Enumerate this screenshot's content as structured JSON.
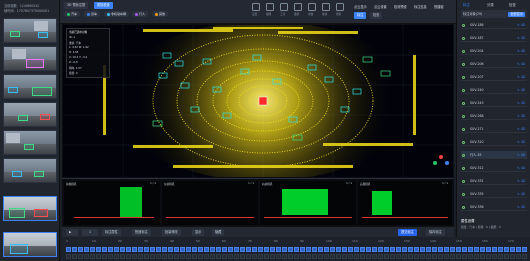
{
  "left": {
    "info_line1": "当前帧数：1/10690542",
    "info_line2": "帧时间：1707807375000001",
    "thumbnails": [
      "cam-1",
      "cam-2",
      "cam-3",
      "cam-4",
      "cam-5",
      "cam-6",
      "cam-7",
      "cam-8"
    ]
  },
  "toolbar": {
    "mode_btn": "3D 预标注框",
    "check_btn": "质检检查",
    "chips": [
      {
        "label": "汽车",
        "color": "#22c55e"
      },
      {
        "label": "货车",
        "color": "#3b82f6"
      },
      {
        "label": "非机动车辆",
        "color": "#38bdf8"
      },
      {
        "label": "行人",
        "color": "#a855f7"
      },
      {
        "label": "其他",
        "color": "#f59e0b"
      }
    ],
    "icon_labels": [
      "设置",
      "视图",
      "工具",
      "撤销",
      "重做",
      "快捷",
      "帮助"
    ],
    "links": [
      "点云显示",
      "点云设置",
      "检测预设",
      "标注信息",
      "快捷键"
    ],
    "tab_active": "标注",
    "tab_other": "检查"
  },
  "infopanel": {
    "title": "当前已选中对象",
    "rows": [
      "ID: 1",
      "类别: 汽车",
      "L: 4.52  W: 1.92",
      "H: 1.65",
      "X: 10.2  Y: -3.4",
      "Z: -0.8",
      "朝向: 1.57",
      "遮挡: 0"
    ]
  },
  "cams": [
    {
      "label": "前视相机",
      "page": "1 / 1"
    },
    {
      "label": "左前相机",
      "page": "1 / 1"
    },
    {
      "label": "右前相机",
      "page": "1 / 1"
    },
    {
      "label": "后视相机",
      "page": "1 / 1"
    }
  ],
  "bottom_toolbar": {
    "frame_value": "1",
    "btn1": "标注属性",
    "btn2": "快速标注",
    "btn3": "批量修改",
    "btn4": "显示",
    "btn5": "隐藏",
    "submit": "提交标注",
    "save": "保存标注"
  },
  "timeline": {
    "ticks": [
      "1",
      "10",
      "20",
      "30",
      "40",
      "50",
      "60",
      "70",
      "80",
      "90",
      "100",
      "110",
      "120",
      "130",
      "140",
      "150",
      "160",
      "170"
    ]
  },
  "right": {
    "tabs": [
      "标注",
      "分类",
      "检查"
    ],
    "header": "标注对象(29)",
    "header_btn": "全部显示",
    "items": [
      "SUV-186",
      "SUV-187",
      "SUV-204",
      "SUV-206",
      "SUV-207",
      "SUV-240",
      "SUV-243",
      "SUV-268",
      "SUV-271",
      "SUV-310",
      "行人-55",
      "SUV-312",
      "SUV-331",
      "SUV-335",
      "SUV-336"
    ],
    "highlighted_index": 10,
    "attr_title": "属性设置",
    "attr_text": "属性：汽车 | 遮挡：0 | 截断：0"
  }
}
